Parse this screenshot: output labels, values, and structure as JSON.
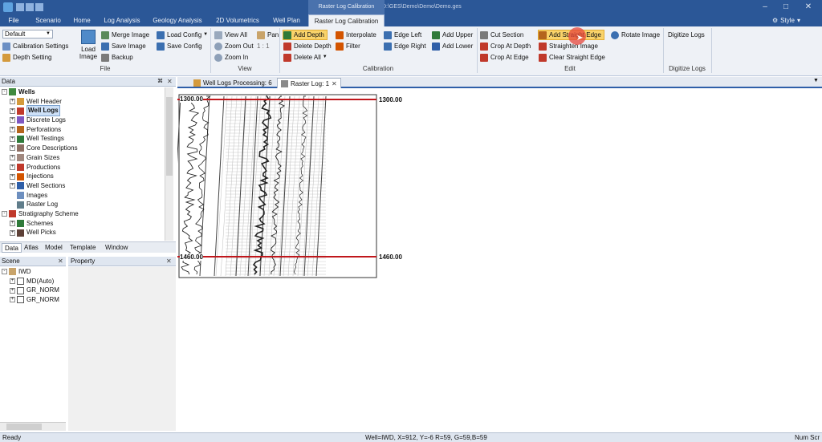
{
  "window": {
    "title": "GES 21 - D:\\GES\\Demo\\Demo\\Demo.ges",
    "context_tab_title": "Raster Log Calibration",
    "style_label": "Style"
  },
  "tabs": [
    {
      "label": "File"
    },
    {
      "label": "Scenario"
    },
    {
      "label": "Home"
    },
    {
      "label": "Log Analysis"
    },
    {
      "label": "Geology Analysis"
    },
    {
      "label": "2D Volumetrics"
    },
    {
      "label": "Well Plan"
    },
    {
      "label": "Raster Log Calibration"
    }
  ],
  "ribbon": {
    "file": {
      "select_value": "Default",
      "calibration_settings": "Calibration Settings",
      "depth_setting": "Depth Setting",
      "load_image": "Load Image",
      "merge_image": "Merge Image",
      "save_image": "Save Image",
      "backup": "Backup",
      "load_config": "Load Config",
      "save_config": "Save Config",
      "label": "File"
    },
    "view": {
      "view_all": "View All",
      "pan": "Pan",
      "zoom_out": "Zoom Out",
      "zoom_ratio": "1 : 1",
      "zoom_in": "Zoom In",
      "label": "View"
    },
    "calibration": {
      "add_depth": "Add Depth",
      "delete_depth": "Delete Depth",
      "delete_all": "Delete All",
      "interpolate": "Interpolate",
      "filter": "Filter",
      "edge_left": "Edge Left",
      "edge_right": "Edge Right",
      "add_upper": "Add Upper",
      "add_lower": "Add Lower",
      "label": "Calibration"
    },
    "edit": {
      "cut_section": "Cut Section",
      "crop_at_depth": "Crop At Depth",
      "crop_at_edge": "Crop At Edge",
      "add_straight_edge": "Add Straight Edge",
      "straighten_image": "Straighten Image",
      "clear_straight_edge": "Clear Straight Edge",
      "rotate_image": "Rotate Image",
      "label": "Edit"
    },
    "digitize": {
      "digitize_logs": "Digitize Logs",
      "label": "Digitize Logs"
    }
  },
  "data_panel": {
    "title": "Data",
    "tree": [
      {
        "label": "Wells",
        "level": 0,
        "bold": true
      },
      {
        "label": "Well Header",
        "level": 1
      },
      {
        "label": "Well Logs",
        "level": 1,
        "selected": true
      },
      {
        "label": "Discrete Logs",
        "level": 1
      },
      {
        "label": "Perforations",
        "level": 1
      },
      {
        "label": "Well Testings",
        "level": 1
      },
      {
        "label": "Core Descriptions",
        "level": 1
      },
      {
        "label": "Grain Sizes",
        "level": 1
      },
      {
        "label": "Productions",
        "level": 1
      },
      {
        "label": "Injections",
        "level": 1
      },
      {
        "label": "Well Sections",
        "level": 1
      },
      {
        "label": "Images",
        "level": 1
      },
      {
        "label": "Raster Log",
        "level": 1
      },
      {
        "label": "Stratigraphy Scheme",
        "level": 0
      },
      {
        "label": "Schemes",
        "level": 1
      },
      {
        "label": "Well Picks",
        "level": 1
      }
    ]
  },
  "panel_tabs": [
    "Data",
    "Atlas",
    "Model",
    "Template",
    "Window"
  ],
  "scene_panel": {
    "title": "Scene",
    "items": [
      "IWD",
      "MD(Auto)",
      "GR_NORM",
      "GR_NORM"
    ]
  },
  "property_panel": {
    "title": "Property"
  },
  "doc_tabs": [
    {
      "label": "Well Logs Processing: 6"
    },
    {
      "label": "Raster Log: 1"
    }
  ],
  "raster": {
    "top_depth_left": "1300.00",
    "top_depth_right": "1300.00",
    "bottom_depth_left": "1460.00",
    "bottom_depth_right": "1460.00"
  },
  "status": {
    "left": "Ready",
    "center": "Well=IWD, X=912, Y=-6 R=59, G=59,B=59",
    "right": "Num Scr"
  }
}
